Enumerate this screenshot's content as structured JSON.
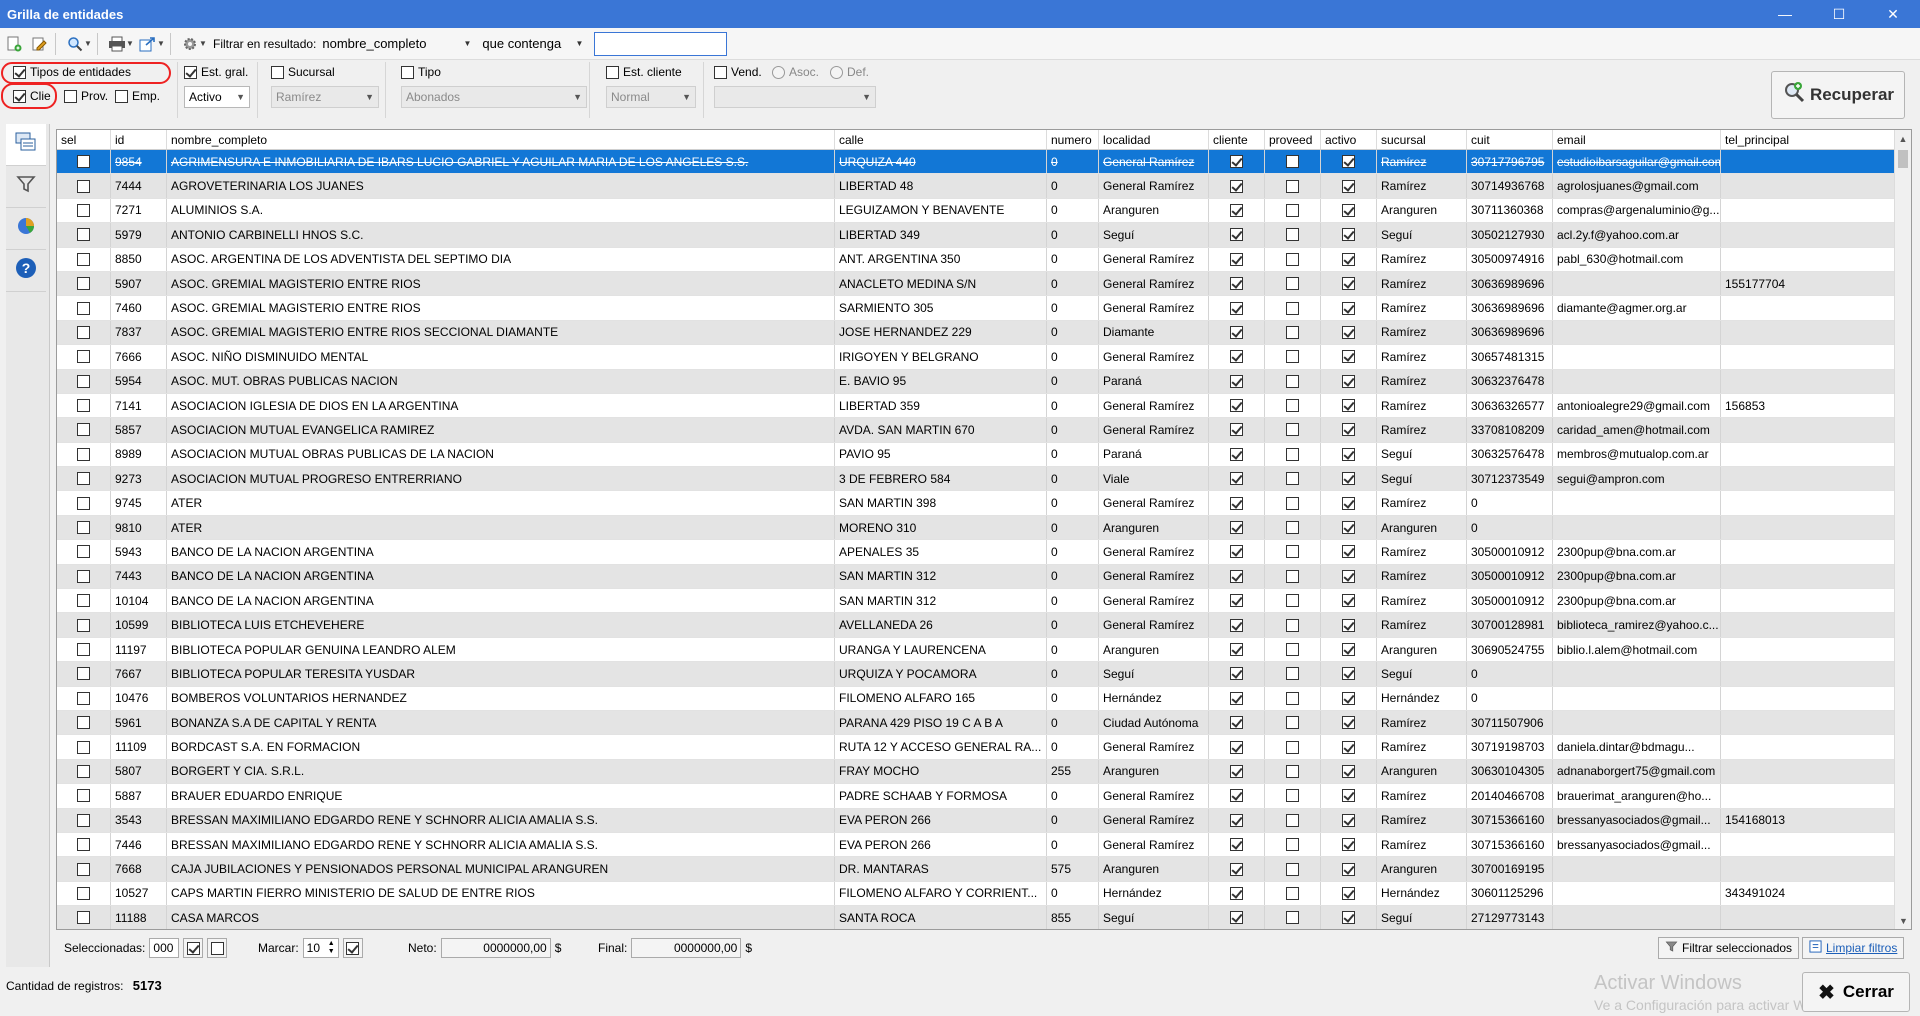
{
  "window": {
    "title": "Grilla de entidades",
    "controls": [
      "—",
      "☐",
      "✕"
    ]
  },
  "toolbar": {
    "filter_label": "Filtrar en resultado:",
    "filter_field": "nombre_completo",
    "filter_mode": "que contenga",
    "filter_value": ""
  },
  "filters": {
    "tipos_label": "Tipos de entidades",
    "clie_label": "Clie",
    "prov_label": "Prov.",
    "emp_label": "Emp.",
    "est_gral_label": "Est. gral.",
    "est_gral_value": "Activo",
    "sucursal_label": "Sucursal",
    "sucursal_value": "Ramírez",
    "tipo_label": "Tipo",
    "tipo_value": "Abonados",
    "est_cliente_label": "Est. cliente",
    "est_cliente_value": "Normal",
    "vend_label": "Vend.",
    "asoc_label": "Asoc.",
    "def_label": "Def.",
    "recuperar_label": "Recuperar"
  },
  "grid": {
    "columns": [
      "sel",
      "id",
      "nombre_completo",
      "calle",
      "numero",
      "localidad",
      "cliente",
      "proveed",
      "activo",
      "sucursal",
      "cuit",
      "email",
      "tel_principal"
    ],
    "rows": [
      {
        "id": "9854",
        "nombre": "AGRIMENSURA E INMOBILIARIA DE IBARS LUCIO GABRIEL Y AGUILAR MARIA DE LOS ANGELES S.S.",
        "calle": "URQUIZA 440",
        "numero": "0",
        "localidad": "General Ramírez",
        "cliente": true,
        "proveed": false,
        "activo": true,
        "sucursal": "Ramírez",
        "cuit": "30717796795",
        "email": "estudioibarsaguilar@gmail.com",
        "tel": ""
      },
      {
        "id": "7444",
        "nombre": "AGROVETERINARIA LOS JUANES",
        "calle": "LIBERTAD 48",
        "numero": "0",
        "localidad": "General Ramírez",
        "cliente": true,
        "proveed": false,
        "activo": true,
        "sucursal": "Ramírez",
        "cuit": "30714936768",
        "email": "agrolosjuanes@gmail.com",
        "tel": ""
      },
      {
        "id": "7271",
        "nombre": "ALUMINIOS S.A.",
        "calle": "LEGUIZAMON Y BENAVENTE",
        "numero": "0",
        "localidad": "Aranguren",
        "cliente": true,
        "proveed": false,
        "activo": true,
        "sucursal": "Aranguren",
        "cuit": "30711360368",
        "email": "compras@argenaluminio@g...",
        "tel": ""
      },
      {
        "id": "5979",
        "nombre": "ANTONIO CARBINELLI HNOS S.C.",
        "calle": "LIBERTAD 349",
        "numero": "0",
        "localidad": "Seguí",
        "cliente": true,
        "proveed": false,
        "activo": true,
        "sucursal": "Seguí",
        "cuit": "30502127930",
        "email": "acl.2y.f@yahoo.com.ar",
        "tel": ""
      },
      {
        "id": "8850",
        "nombre": "ASOC. ARGENTINA DE LOS ADVENTISTA DEL SEPTIMO DIA",
        "calle": "ANT. ARGENTINA 350",
        "numero": "0",
        "localidad": "General Ramírez",
        "cliente": true,
        "proveed": false,
        "activo": true,
        "sucursal": "Ramírez",
        "cuit": "30500974916",
        "email": "pabl_630@hotmail.com",
        "tel": ""
      },
      {
        "id": "5907",
        "nombre": "ASOC. GREMIAL MAGISTERIO ENTRE RIOS",
        "calle": "ANACLETO MEDINA S/N",
        "numero": "0",
        "localidad": "General Ramírez",
        "cliente": true,
        "proveed": false,
        "activo": true,
        "sucursal": "Ramírez",
        "cuit": "30636989696",
        "email": "",
        "tel": "155177704"
      },
      {
        "id": "7460",
        "nombre": "ASOC. GREMIAL MAGISTERIO ENTRE RIOS",
        "calle": "SARMIENTO 305",
        "numero": "0",
        "localidad": "General Ramírez",
        "cliente": true,
        "proveed": false,
        "activo": true,
        "sucursal": "Ramírez",
        "cuit": "30636989696",
        "email": "diamante@agmer.org.ar",
        "tel": ""
      },
      {
        "id": "7837",
        "nombre": "ASOC. GREMIAL MAGISTERIO ENTRE RIOS SECCIONAL DIAMANTE",
        "calle": "JOSE HERNANDEZ 229",
        "numero": "0",
        "localidad": "Diamante",
        "cliente": true,
        "proveed": false,
        "activo": true,
        "sucursal": "Ramírez",
        "cuit": "30636989696",
        "email": "",
        "tel": ""
      },
      {
        "id": "7666",
        "nombre": "ASOC. NIÑO DISMINUIDO MENTAL",
        "calle": "IRIGOYEN Y BELGRANO",
        "numero": "0",
        "localidad": "General Ramírez",
        "cliente": true,
        "proveed": false,
        "activo": true,
        "sucursal": "Ramírez",
        "cuit": "30657481315",
        "email": "",
        "tel": ""
      },
      {
        "id": "5954",
        "nombre": "ASOC. MUT. OBRAS PUBLICAS NACION",
        "calle": "E. BAVIO 95",
        "numero": "0",
        "localidad": "Paraná",
        "cliente": true,
        "proveed": false,
        "activo": true,
        "sucursal": "Ramírez",
        "cuit": "30632376478",
        "email": "",
        "tel": ""
      },
      {
        "id": "7141",
        "nombre": "ASOCIACION IGLESIA DE DIOS EN LA ARGENTINA",
        "calle": "LIBERTAD 359",
        "numero": "0",
        "localidad": "General Ramírez",
        "cliente": true,
        "proveed": false,
        "activo": true,
        "sucursal": "Ramírez",
        "cuit": "30636326577",
        "email": "antonioalegre29@gmail.com",
        "tel": "156853"
      },
      {
        "id": "5857",
        "nombre": "ASOCIACION MUTUAL EVANGELICA RAMIREZ",
        "calle": "AVDA. SAN MARTIN 670",
        "numero": "0",
        "localidad": "General Ramírez",
        "cliente": true,
        "proveed": false,
        "activo": true,
        "sucursal": "Ramírez",
        "cuit": "33708108209",
        "email": "caridad_amen@hotmail.com",
        "tel": ""
      },
      {
        "id": "8989",
        "nombre": "ASOCIACION MUTUAL OBRAS PUBLICAS DE LA NACION",
        "calle": "PAVIO 95",
        "numero": "0",
        "localidad": "Paraná",
        "cliente": true,
        "proveed": false,
        "activo": true,
        "sucursal": "Seguí",
        "cuit": "30632576478",
        "email": "membros@mutualop.com.ar",
        "tel": ""
      },
      {
        "id": "9273",
        "nombre": "ASOCIACION MUTUAL PROGRESO ENTRERRIANO",
        "calle": "3 DE FEBRERO 584",
        "numero": "0",
        "localidad": "Viale",
        "cliente": true,
        "proveed": false,
        "activo": true,
        "sucursal": "Seguí",
        "cuit": "30712373549",
        "email": "segui@ampron.com",
        "tel": ""
      },
      {
        "id": "9745",
        "nombre": "ATER",
        "calle": "SAN MARTIN 398",
        "numero": "0",
        "localidad": "General Ramírez",
        "cliente": true,
        "proveed": false,
        "activo": true,
        "sucursal": "Ramírez",
        "cuit": "0",
        "email": "",
        "tel": ""
      },
      {
        "id": "9810",
        "nombre": "ATER",
        "calle": "MORENO 310",
        "numero": "0",
        "localidad": "Aranguren",
        "cliente": true,
        "proveed": false,
        "activo": true,
        "sucursal": "Aranguren",
        "cuit": "0",
        "email": "",
        "tel": ""
      },
      {
        "id": "5943",
        "nombre": "BANCO DE LA NACION ARGENTINA",
        "calle": "APENALES 35",
        "numero": "0",
        "localidad": "General Ramírez",
        "cliente": true,
        "proveed": false,
        "activo": true,
        "sucursal": "Ramírez",
        "cuit": "30500010912",
        "email": "2300pup@bna.com.ar",
        "tel": ""
      },
      {
        "id": "7443",
        "nombre": "BANCO DE LA NACION ARGENTINA",
        "calle": "SAN MARTIN 312",
        "numero": "0",
        "localidad": "General Ramírez",
        "cliente": true,
        "proveed": false,
        "activo": true,
        "sucursal": "Ramírez",
        "cuit": "30500010912",
        "email": "2300pup@bna.com.ar",
        "tel": ""
      },
      {
        "id": "10104",
        "nombre": "BANCO DE LA NACION ARGENTINA",
        "calle": "SAN MARTIN 312",
        "numero": "0",
        "localidad": "General Ramírez",
        "cliente": true,
        "proveed": false,
        "activo": true,
        "sucursal": "Ramírez",
        "cuit": "30500010912",
        "email": "2300pup@bna.com.ar",
        "tel": ""
      },
      {
        "id": "10599",
        "nombre": "BIBLIOTECA LUIS ETCHEVEHERE",
        "calle": "AVELLANEDA 26",
        "numero": "0",
        "localidad": "General Ramírez",
        "cliente": true,
        "proveed": false,
        "activo": true,
        "sucursal": "Ramírez",
        "cuit": "30700128981",
        "email": "biblioteca_ramirez@yahoo.c...",
        "tel": ""
      },
      {
        "id": "11197",
        "nombre": "BIBLIOTECA POPULAR GENUINA LEANDRO ALEM",
        "calle": "URANGA Y LAURENCENA",
        "numero": "0",
        "localidad": "Aranguren",
        "cliente": true,
        "proveed": false,
        "activo": true,
        "sucursal": "Aranguren",
        "cuit": "30690524755",
        "email": "biblio.l.alem@hotmail.com",
        "tel": ""
      },
      {
        "id": "7667",
        "nombre": "BIBLIOTECA POPULAR TERESITA YUSDAR",
        "calle": "URQUIZA Y POCAMORA",
        "numero": "0",
        "localidad": "Seguí",
        "cliente": true,
        "proveed": false,
        "activo": true,
        "sucursal": "Seguí",
        "cuit": "0",
        "email": "",
        "tel": ""
      },
      {
        "id": "10476",
        "nombre": "BOMBEROS VOLUNTARIOS HERNANDEZ",
        "calle": "FILOMENO ALFARO 165",
        "numero": "0",
        "localidad": "Hernández",
        "cliente": true,
        "proveed": false,
        "activo": true,
        "sucursal": "Hernández",
        "cuit": "0",
        "email": "",
        "tel": ""
      },
      {
        "id": "5961",
        "nombre": "BONANZA S.A DE CAPITAL Y RENTA",
        "calle": "PARANA 429 PISO 19 C A B A",
        "numero": "0",
        "localidad": "Ciudad Autónoma",
        "cliente": true,
        "proveed": false,
        "activo": true,
        "sucursal": "Ramírez",
        "cuit": "30711507906",
        "email": "",
        "tel": ""
      },
      {
        "id": "11109",
        "nombre": "BORDCAST S.A. EN FORMACION",
        "calle": "RUTA 12 Y ACCESO GENERAL RA...",
        "numero": "0",
        "localidad": "General Ramírez",
        "cliente": true,
        "proveed": false,
        "activo": true,
        "sucursal": "Ramírez",
        "cuit": "30719198703",
        "email": "daniela.dintar@bdmagu...",
        "tel": ""
      },
      {
        "id": "5807",
        "nombre": "BORGERT Y CIA. S.R.L.",
        "calle": "FRAY MOCHO",
        "numero": "255",
        "localidad": "Aranguren",
        "cliente": true,
        "proveed": false,
        "activo": true,
        "sucursal": "Aranguren",
        "cuit": "30630104305",
        "email": "adnanaborgert75@gmail.com",
        "tel": ""
      },
      {
        "id": "5887",
        "nombre": "BRAUER EDUARDO ENRIQUE",
        "calle": "PADRE SCHAAB Y FORMOSA",
        "numero": "0",
        "localidad": "General Ramírez",
        "cliente": true,
        "proveed": false,
        "activo": true,
        "sucursal": "Ramírez",
        "cuit": "20140466708",
        "email": "brauerimat_aranguren@ho...",
        "tel": ""
      },
      {
        "id": "3543",
        "nombre": "BRESSAN MAXIMILIANO EDGARDO RENE Y SCHNORR ALICIA AMALIA S.S.",
        "calle": "EVA PERON 266",
        "numero": "0",
        "localidad": "General Ramírez",
        "cliente": true,
        "proveed": false,
        "activo": true,
        "sucursal": "Ramírez",
        "cuit": "30715366160",
        "email": "bressanyasociados@gmail...",
        "tel": "154168013"
      },
      {
        "id": "7446",
        "nombre": "BRESSAN MAXIMILIANO EDGARDO RENE Y SCHNORR ALICIA AMALIA S.S.",
        "calle": "EVA PERON 266",
        "numero": "0",
        "localidad": "General Ramírez",
        "cliente": true,
        "proveed": false,
        "activo": true,
        "sucursal": "Ramírez",
        "cuit": "30715366160",
        "email": "bressanyasociados@gmail...",
        "tel": ""
      },
      {
        "id": "7668",
        "nombre": "CAJA JUBILACIONES Y PENSIONADOS PERSONAL MUNICIPAL ARANGUREN",
        "calle": "DR. MANTARAS",
        "numero": "575",
        "localidad": "Aranguren",
        "cliente": true,
        "proveed": false,
        "activo": true,
        "sucursal": "Aranguren",
        "cuit": "30700169195",
        "email": "",
        "tel": ""
      },
      {
        "id": "10527",
        "nombre": "CAPS MARTIN FIERRO MINISTERIO DE SALUD DE ENTRE RIOS",
        "calle": "FILOMENO ALFARO Y CORRIENT...",
        "numero": "0",
        "localidad": "Hernández",
        "cliente": true,
        "proveed": false,
        "activo": true,
        "sucursal": "Hernández",
        "cuit": "30601125296",
        "email": "",
        "tel": "343491024"
      },
      {
        "id": "11188",
        "nombre": "CASA MARCOS",
        "calle": "SANTA ROCA",
        "numero": "855",
        "localidad": "Seguí",
        "cliente": true,
        "proveed": false,
        "activo": true,
        "sucursal": "Seguí",
        "cuit": "27129773143",
        "email": "",
        "tel": ""
      }
    ]
  },
  "bottombar": {
    "seleccionadas_label": "Seleccionadas:",
    "seleccionadas_value": "000",
    "marcar_label": "Marcar:",
    "marcar_value": "10",
    "neto_label": "Neto:",
    "neto_value": "0000000,00",
    "neto_unit": "$",
    "final_label": "Final:",
    "final_value": "0000000,00",
    "final_unit": "$",
    "filtrar_sel_label": "Filtrar seleccionados",
    "limpiar_label": "Limpiar filtros"
  },
  "status": {
    "count_label": "Cantidad de registros:",
    "count_value": "5173",
    "cerrar_label": "Cerrar",
    "watermark_line1": "Activar Windows",
    "watermark_line2": "Ve a Configuración para activar Windows."
  }
}
